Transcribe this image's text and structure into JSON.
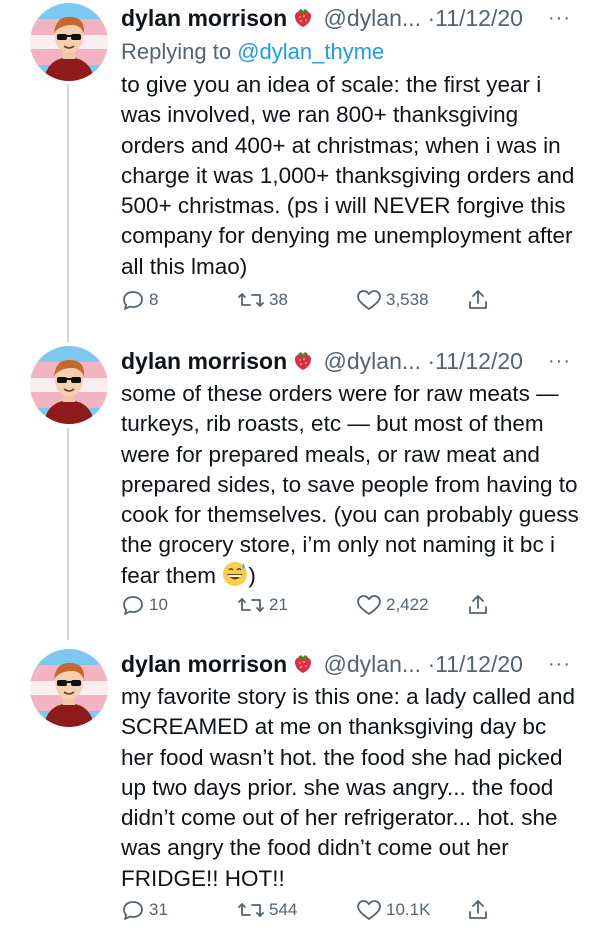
{
  "tweets": [
    {
      "name": "dylan morrison",
      "handle": "@dylan...",
      "dot": "·",
      "date": "11/12/20",
      "more": "···",
      "replying_prefix": "Replying to ",
      "replying_to": "@dylan_thyme",
      "text": "to give you an idea of scale: the first year i was involved, we ran 800+ thanksgiving orders and 400+ at christmas; when i was in charge it was 1,000+ thanksgiving orders and 500+ christmas. (ps i will NEVER forgive this company for denying me unemployment after all this lmao)",
      "replies": "8",
      "retweets": "38",
      "likes": "3,538"
    },
    {
      "name": "dylan morrison",
      "handle": "@dylan...",
      "dot": "·",
      "date": "11/12/20",
      "more": "···",
      "text": "some of these orders were for raw meats — turkeys, rib roasts, etc — but most of them were for prepared meals, or raw meat and prepared sides, to save people from having to cook for themselves. (you can probably guess the grocery store, i’m only not naming it bc i fear them",
      "text_end": ")",
      "emoji": "grinning-sweat-emoji",
      "replies": "10",
      "retweets": "21",
      "likes": "2,422"
    },
    {
      "name": "dylan morrison",
      "handle": "@dylan...",
      "dot": "·",
      "date": "11/12/20",
      "more": "···",
      "text": "my favorite story is this one: a lady called and SCREAMED at me on thanksgiving day bc her food wasn’t hot. the food she had picked up two days prior. she was angry... the food didn’t come out of her refrigerator... hot. she was angry the food didn’t come out her FRIDGE!! HOT!!",
      "replies": "31",
      "retweets": "544",
      "likes": "10.1K"
    }
  ],
  "icons": {
    "name_badge": "strawberry-icon",
    "reply": "reply-icon",
    "retweet": "retweet-icon",
    "like": "heart-icon",
    "share": "share-icon"
  },
  "colors": {
    "link": "#1d9bf0",
    "secondary_text": "#536471",
    "thread_line": "#cfd9de",
    "avatar_flag": [
      "#5bcefa",
      "#f5a9b8",
      "#ffffff"
    ]
  }
}
